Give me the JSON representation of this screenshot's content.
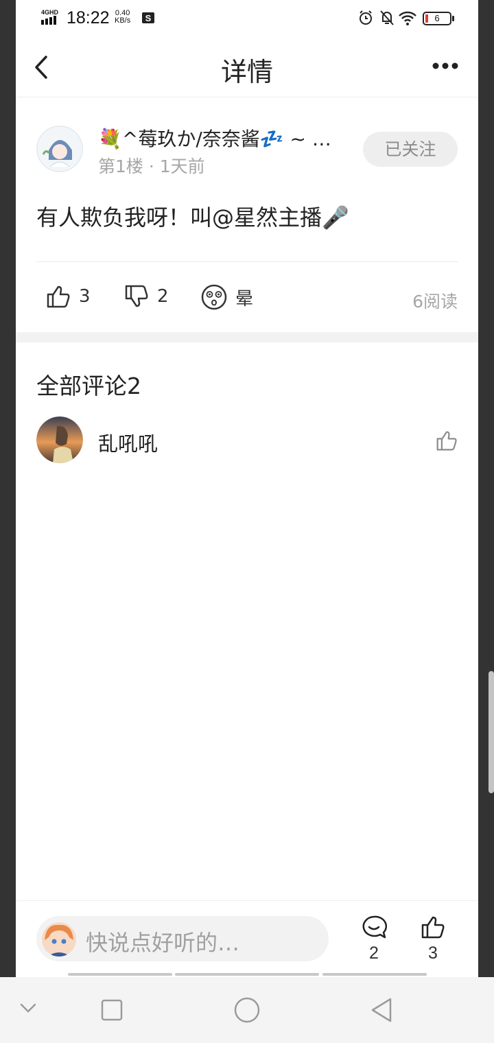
{
  "status_bar": {
    "network": "4GHD",
    "time": "18:22",
    "speed_value": "0.40",
    "speed_unit": "KB/s",
    "battery": "6"
  },
  "header": {
    "title": "详情"
  },
  "post": {
    "author": "💐^莓玖か/奈奈酱💤 ~ …",
    "meta": "第1楼 · 1天前",
    "follow_label": "已关注",
    "content": "有人欺负我呀！叫@星然主播🎤",
    "like_count": "3",
    "dislike_count": "2",
    "reaction_label": "晕",
    "read_count": "6阅读"
  },
  "comments": {
    "section_title": "全部评论2",
    "items": [
      {
        "name": "乱吼吼"
      }
    ]
  },
  "bottom_bar": {
    "input_placeholder": "快说点好听的…",
    "comment_count": "2",
    "like_count": "3"
  },
  "colors": {
    "follow_bg": "#eeeeee",
    "muted_text": "#a6a6a6",
    "section_band": "#f2f2f2"
  }
}
